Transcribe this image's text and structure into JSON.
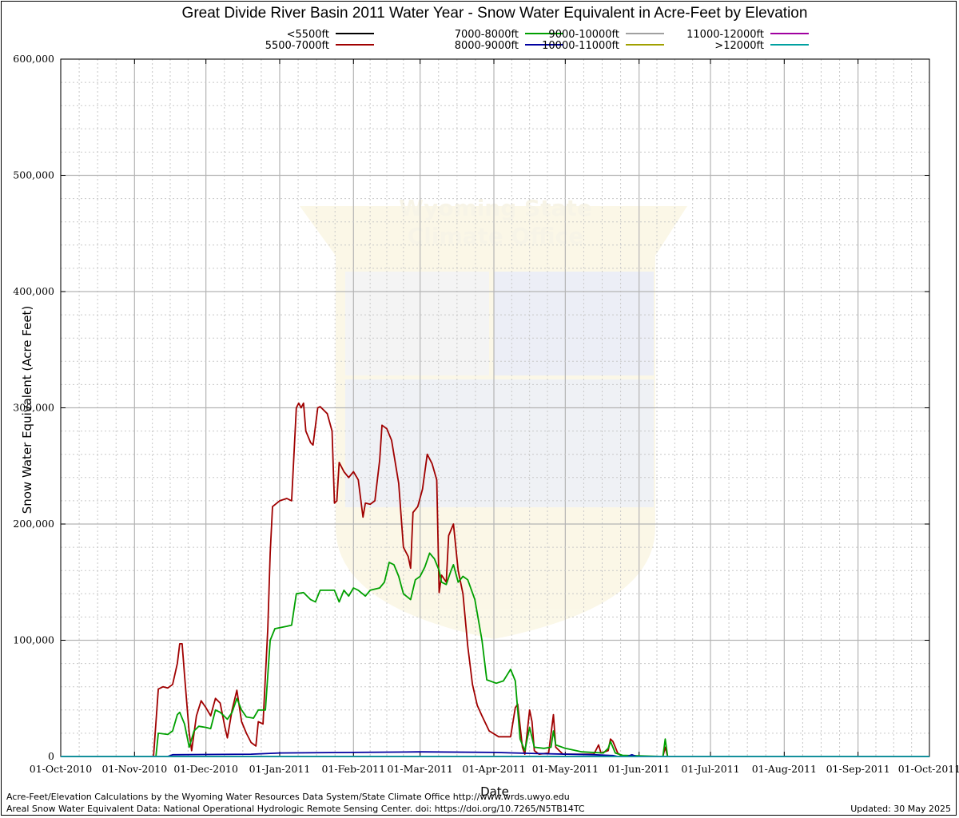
{
  "chart_data": {
    "type": "line",
    "title": "Great Divide River Basin 2011 Water Year - Snow Water Equivalent in Acre-Feet by Elevation",
    "xlabel": "Date",
    "ylabel": "Snow Water Equivalent (Acre Feet)",
    "ylim": [
      0,
      600000
    ],
    "yticks": [
      "0",
      "100,000",
      "200,000",
      "300,000",
      "400,000",
      "500,000",
      "600,000"
    ],
    "x_start": "2010-10-01",
    "x_end": "2011-10-01",
    "xtick_labels": [
      "01-Oct-2010",
      "01-Nov-2010",
      "01-Dec-2010",
      "01-Jan-2011",
      "01-Feb-2011",
      "01-Mar-2011",
      "01-Apr-2011",
      "01-May-2011",
      "01-Jun-2011",
      "01-Jul-2011",
      "01-Aug-2011",
      "01-Sep-2011",
      "01-Oct-2011"
    ],
    "xtick_dates": [
      "2010-10-01",
      "2010-11-01",
      "2010-12-01",
      "2011-01-01",
      "2011-02-01",
      "2011-03-01",
      "2011-04-01",
      "2011-05-01",
      "2011-06-01",
      "2011-07-01",
      "2011-08-01",
      "2011-09-01",
      "2011-10-01"
    ],
    "grid": true,
    "legend_position": "top",
    "series": [
      {
        "name": "<5500ft",
        "color": "#000000",
        "points": [
          [
            "2010-10-01",
            0
          ],
          [
            "2011-10-01",
            0
          ]
        ]
      },
      {
        "name": "5500-7000ft",
        "color": "#a00000",
        "points": [
          [
            "2010-10-01",
            0
          ],
          [
            "2010-11-09",
            0
          ],
          [
            "2010-11-11",
            58000
          ],
          [
            "2010-11-13",
            60000
          ],
          [
            "2010-11-15",
            59000
          ],
          [
            "2010-11-17",
            62000
          ],
          [
            "2010-11-19",
            80000
          ],
          [
            "2010-11-20",
            97000
          ],
          [
            "2010-11-21",
            97000
          ],
          [
            "2010-11-22",
            70000
          ],
          [
            "2010-11-24",
            20000
          ],
          [
            "2010-11-25",
            5000
          ],
          [
            "2010-11-27",
            35000
          ],
          [
            "2010-11-29",
            48000
          ],
          [
            "2010-12-01",
            42000
          ],
          [
            "2010-12-03",
            35000
          ],
          [
            "2010-12-05",
            50000
          ],
          [
            "2010-12-07",
            46000
          ],
          [
            "2010-12-09",
            25000
          ],
          [
            "2010-12-10",
            16000
          ],
          [
            "2010-12-12",
            40000
          ],
          [
            "2010-12-14",
            57000
          ],
          [
            "2010-12-16",
            30000
          ],
          [
            "2010-12-18",
            20000
          ],
          [
            "2010-12-20",
            12000
          ],
          [
            "2010-12-22",
            9000
          ],
          [
            "2010-12-23",
            30000
          ],
          [
            "2010-12-25",
            28000
          ],
          [
            "2010-12-27",
            110000
          ],
          [
            "2010-12-28",
            175000
          ],
          [
            "2010-12-29",
            215000
          ],
          [
            "2011-01-01",
            220000
          ],
          [
            "2011-01-04",
            222000
          ],
          [
            "2011-01-06",
            220000
          ],
          [
            "2011-01-08",
            300000
          ],
          [
            "2011-01-09",
            304000
          ],
          [
            "2011-01-10",
            300000
          ],
          [
            "2011-01-11",
            304000
          ],
          [
            "2011-01-12",
            280000
          ],
          [
            "2011-01-14",
            270000
          ],
          [
            "2011-01-15",
            268000
          ],
          [
            "2011-01-17",
            300000
          ],
          [
            "2011-01-18",
            301000
          ],
          [
            "2011-01-21",
            295000
          ],
          [
            "2011-01-23",
            280000
          ],
          [
            "2011-01-24",
            218000
          ],
          [
            "2011-01-25",
            220000
          ],
          [
            "2011-01-26",
            253000
          ],
          [
            "2011-01-28",
            245000
          ],
          [
            "2011-01-30",
            240000
          ],
          [
            "2011-02-01",
            245000
          ],
          [
            "2011-02-03",
            238000
          ],
          [
            "2011-02-05",
            206000
          ],
          [
            "2011-02-06",
            218000
          ],
          [
            "2011-02-08",
            217000
          ],
          [
            "2011-02-10",
            220000
          ],
          [
            "2011-02-12",
            255000
          ],
          [
            "2011-02-13",
            285000
          ],
          [
            "2011-02-15",
            282000
          ],
          [
            "2011-02-17",
            272000
          ],
          [
            "2011-02-20",
            235000
          ],
          [
            "2011-02-22",
            180000
          ],
          [
            "2011-02-24",
            172000
          ],
          [
            "2011-02-25",
            162000
          ],
          [
            "2011-02-26",
            210000
          ],
          [
            "2011-02-28",
            215000
          ],
          [
            "2011-03-02",
            230000
          ],
          [
            "2011-03-04",
            260000
          ],
          [
            "2011-03-06",
            252000
          ],
          [
            "2011-03-08",
            238000
          ],
          [
            "2011-03-09",
            141000
          ],
          [
            "2011-03-10",
            156000
          ],
          [
            "2011-03-12",
            150000
          ],
          [
            "2011-03-13",
            190000
          ],
          [
            "2011-03-15",
            200000
          ],
          [
            "2011-03-17",
            160000
          ],
          [
            "2011-03-19",
            140000
          ],
          [
            "2011-03-21",
            95000
          ],
          [
            "2011-03-23",
            62000
          ],
          [
            "2011-03-25",
            44000
          ],
          [
            "2011-03-27",
            35000
          ],
          [
            "2011-03-30",
            22000
          ],
          [
            "2011-04-03",
            17000
          ],
          [
            "2011-04-08",
            17000
          ],
          [
            "2011-04-10",
            42000
          ],
          [
            "2011-04-11",
            45000
          ],
          [
            "2011-04-13",
            8000
          ],
          [
            "2011-04-14",
            2000
          ],
          [
            "2011-04-16",
            40000
          ],
          [
            "2011-04-17",
            30000
          ],
          [
            "2011-04-18",
            5000
          ],
          [
            "2011-04-20",
            2000
          ],
          [
            "2011-04-24",
            3000
          ],
          [
            "2011-04-26",
            36000
          ],
          [
            "2011-04-27",
            8000
          ],
          [
            "2011-04-30",
            2000
          ],
          [
            "2011-05-13",
            2000
          ],
          [
            "2011-05-15",
            10000
          ],
          [
            "2011-05-16",
            3000
          ],
          [
            "2011-05-19",
            5000
          ],
          [
            "2011-05-20",
            15000
          ],
          [
            "2011-05-21",
            13000
          ],
          [
            "2011-05-23",
            3000
          ],
          [
            "2011-05-25",
            0
          ],
          [
            "2011-06-11",
            0
          ],
          [
            "2011-06-12",
            8000
          ],
          [
            "2011-06-13",
            0
          ],
          [
            "2011-10-01",
            0
          ]
        ]
      },
      {
        "name": "7000-8000ft",
        "color": "#00a000",
        "points": [
          [
            "2010-10-01",
            0
          ],
          [
            "2010-11-10",
            0
          ],
          [
            "2010-11-11",
            20000
          ],
          [
            "2010-11-15",
            19000
          ],
          [
            "2010-11-17",
            22000
          ],
          [
            "2010-11-19",
            36000
          ],
          [
            "2010-11-20",
            38000
          ],
          [
            "2010-11-22",
            28000
          ],
          [
            "2010-11-24",
            8000
          ],
          [
            "2010-11-26",
            22000
          ],
          [
            "2010-11-28",
            26000
          ],
          [
            "2010-12-01",
            25000
          ],
          [
            "2010-12-03",
            24000
          ],
          [
            "2010-12-05",
            40000
          ],
          [
            "2010-12-07",
            38000
          ],
          [
            "2010-12-10",
            32000
          ],
          [
            "2010-12-12",
            38000
          ],
          [
            "2010-12-14",
            50000
          ],
          [
            "2010-12-16",
            40000
          ],
          [
            "2010-12-18",
            34000
          ],
          [
            "2010-12-21",
            33000
          ],
          [
            "2010-12-23",
            40000
          ],
          [
            "2010-12-26",
            40000
          ],
          [
            "2010-12-28",
            100000
          ],
          [
            "2010-12-30",
            110000
          ],
          [
            "2011-01-04",
            112000
          ],
          [
            "2011-01-06",
            113000
          ],
          [
            "2011-01-08",
            140000
          ],
          [
            "2011-01-11",
            141000
          ],
          [
            "2011-01-14",
            135000
          ],
          [
            "2011-01-16",
            133000
          ],
          [
            "2011-01-18",
            143000
          ],
          [
            "2011-01-21",
            143000
          ],
          [
            "2011-01-24",
            143000
          ],
          [
            "2011-01-26",
            133000
          ],
          [
            "2011-01-28",
            143000
          ],
          [
            "2011-01-30",
            138000
          ],
          [
            "2011-02-01",
            145000
          ],
          [
            "2011-02-03",
            143000
          ],
          [
            "2011-02-06",
            138000
          ],
          [
            "2011-02-08",
            143000
          ],
          [
            "2011-02-12",
            145000
          ],
          [
            "2011-02-14",
            150000
          ],
          [
            "2011-02-16",
            167000
          ],
          [
            "2011-02-18",
            165000
          ],
          [
            "2011-02-20",
            155000
          ],
          [
            "2011-02-22",
            140000
          ],
          [
            "2011-02-25",
            135000
          ],
          [
            "2011-02-27",
            152000
          ],
          [
            "2011-03-01",
            155000
          ],
          [
            "2011-03-03",
            163000
          ],
          [
            "2011-03-05",
            175000
          ],
          [
            "2011-03-07",
            170000
          ],
          [
            "2011-03-09",
            160000
          ],
          [
            "2011-03-10",
            150000
          ],
          [
            "2011-03-12",
            148000
          ],
          [
            "2011-03-14",
            160000
          ],
          [
            "2011-03-15",
            165000
          ],
          [
            "2011-03-17",
            150000
          ],
          [
            "2011-03-19",
            155000
          ],
          [
            "2011-03-21",
            152000
          ],
          [
            "2011-03-24",
            135000
          ],
          [
            "2011-03-27",
            100000
          ],
          [
            "2011-03-29",
            66000
          ],
          [
            "2011-04-02",
            63000
          ],
          [
            "2011-04-05",
            65000
          ],
          [
            "2011-04-08",
            75000
          ],
          [
            "2011-04-10",
            65000
          ],
          [
            "2011-04-12",
            15000
          ],
          [
            "2011-04-14",
            5000
          ],
          [
            "2011-04-16",
            25000
          ],
          [
            "2011-04-18",
            8000
          ],
          [
            "2011-04-22",
            7000
          ],
          [
            "2011-04-25",
            8000
          ],
          [
            "2011-04-26",
            22000
          ],
          [
            "2011-04-27",
            10000
          ],
          [
            "2011-05-01",
            7000
          ],
          [
            "2011-05-08",
            4000
          ],
          [
            "2011-05-17",
            3000
          ],
          [
            "2011-05-19",
            7000
          ],
          [
            "2011-05-20",
            13000
          ],
          [
            "2011-05-22",
            3000
          ],
          [
            "2011-05-25",
            1000
          ],
          [
            "2011-06-11",
            0
          ],
          [
            "2011-06-12",
            15000
          ],
          [
            "2011-06-13",
            0
          ],
          [
            "2011-10-01",
            0
          ]
        ]
      },
      {
        "name": "8000-9000ft",
        "color": "#0000a0",
        "points": [
          [
            "2010-10-01",
            0
          ],
          [
            "2010-11-15",
            0
          ],
          [
            "2010-11-17",
            1500
          ],
          [
            "2010-12-20",
            2000
          ],
          [
            "2011-01-01",
            3000
          ],
          [
            "2011-02-01",
            3500
          ],
          [
            "2011-03-01",
            4000
          ],
          [
            "2011-04-01",
            3500
          ],
          [
            "2011-04-20",
            2500
          ],
          [
            "2011-05-13",
            1500
          ],
          [
            "2011-05-21",
            800
          ],
          [
            "2011-05-23",
            0
          ],
          [
            "2011-05-27",
            0
          ],
          [
            "2011-05-29",
            1500
          ],
          [
            "2011-05-31",
            0
          ],
          [
            "2011-10-01",
            0
          ]
        ]
      },
      {
        "name": "9000-10000ft",
        "color": "#a0a0a0",
        "points": [
          [
            "2010-10-01",
            0
          ],
          [
            "2011-10-01",
            0
          ]
        ]
      },
      {
        "name": "10000-11000ft",
        "color": "#a0a000",
        "points": [
          [
            "2010-10-01",
            0
          ],
          [
            "2011-10-01",
            0
          ]
        ]
      },
      {
        "name": "11000-12000ft",
        "color": "#a000a0",
        "points": [
          [
            "2010-10-01",
            0
          ],
          [
            "2011-10-01",
            0
          ]
        ]
      },
      {
        "name": ">12000ft",
        "color": "#00a0a0",
        "points": [
          [
            "2010-10-01",
            0
          ],
          [
            "2011-10-01",
            0
          ]
        ]
      }
    ]
  },
  "footer": {
    "credit_line_1": "Acre-Feet/Elevation Calculations by the Wyoming Water Resources Data System/State Climate Office http://www.wrds.uwyo.edu",
    "credit_line_2": "Areal Snow Water Equivalent Data: National Operational Hydrologic Remote Sensing Center. doi: https://doi.org/10.7265/N5TB14TC",
    "updated": "Updated: 30 May 2025"
  },
  "watermark": {
    "text_line_1": "Wyoming State",
    "text_line_2": "Climate Office"
  }
}
